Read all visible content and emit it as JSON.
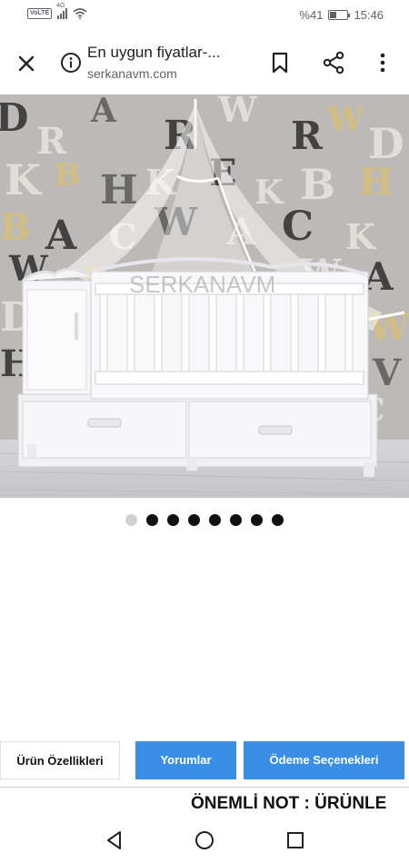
{
  "status_bar": {
    "volte": "VoLTE",
    "network": "4G",
    "battery": "%41",
    "battery_level": 0.41,
    "time": "15:46"
  },
  "toolbar": {
    "title": "En uygun fiyatlar-...",
    "url": "serkanavm.com",
    "icons": [
      "close-icon",
      "info-icon",
      "bookmark-icon",
      "share-icon",
      "more-vert-icon"
    ]
  },
  "product_image": {
    "watermark": "SERKANAVM",
    "wallpaper_letters": [
      "D",
      "R",
      "C",
      "A",
      "W",
      "K",
      "E",
      "B",
      "H"
    ]
  },
  "carousel": {
    "count": 8,
    "active_index": 0
  },
  "tabs": {
    "specs": "Ürün Özellikleri",
    "reviews": "Yorumlar",
    "payment": "Ödeme Seçenekleri"
  },
  "note": "ÖNEMLİ NOT : ÜRÜNLE",
  "colors": {
    "tab_active": "#3a8ee6",
    "icon_gray": "#5f6368"
  },
  "nav": {
    "icons": [
      "back-icon",
      "home-icon",
      "recents-icon"
    ]
  }
}
